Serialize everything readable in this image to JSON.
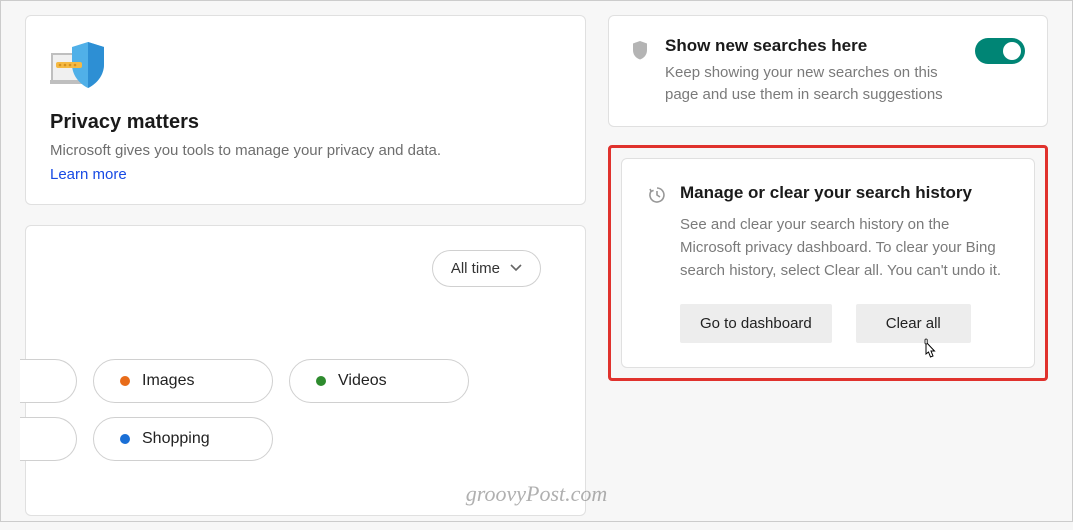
{
  "privacy": {
    "title": "Privacy matters",
    "description": "Microsoft gives you tools to manage your privacy and data.",
    "learn_more": "Learn more"
  },
  "filter": {
    "dropdown_label": "All time",
    "chips": {
      "images": "Images",
      "videos": "Videos",
      "shopping": "Shopping"
    }
  },
  "show_searches": {
    "title": "Show new searches here",
    "description": "Keep showing your new searches on this page and use them in search suggestions",
    "enabled": true
  },
  "manage": {
    "title": "Manage or clear your search history",
    "description": "See and clear your search history on the Microsoft privacy dashboard. To clear your Bing search history, select Clear all. You can't undo it.",
    "go_to_dashboard": "Go to dashboard",
    "clear_all": "Clear all"
  },
  "watermark": "groovyPost.com"
}
